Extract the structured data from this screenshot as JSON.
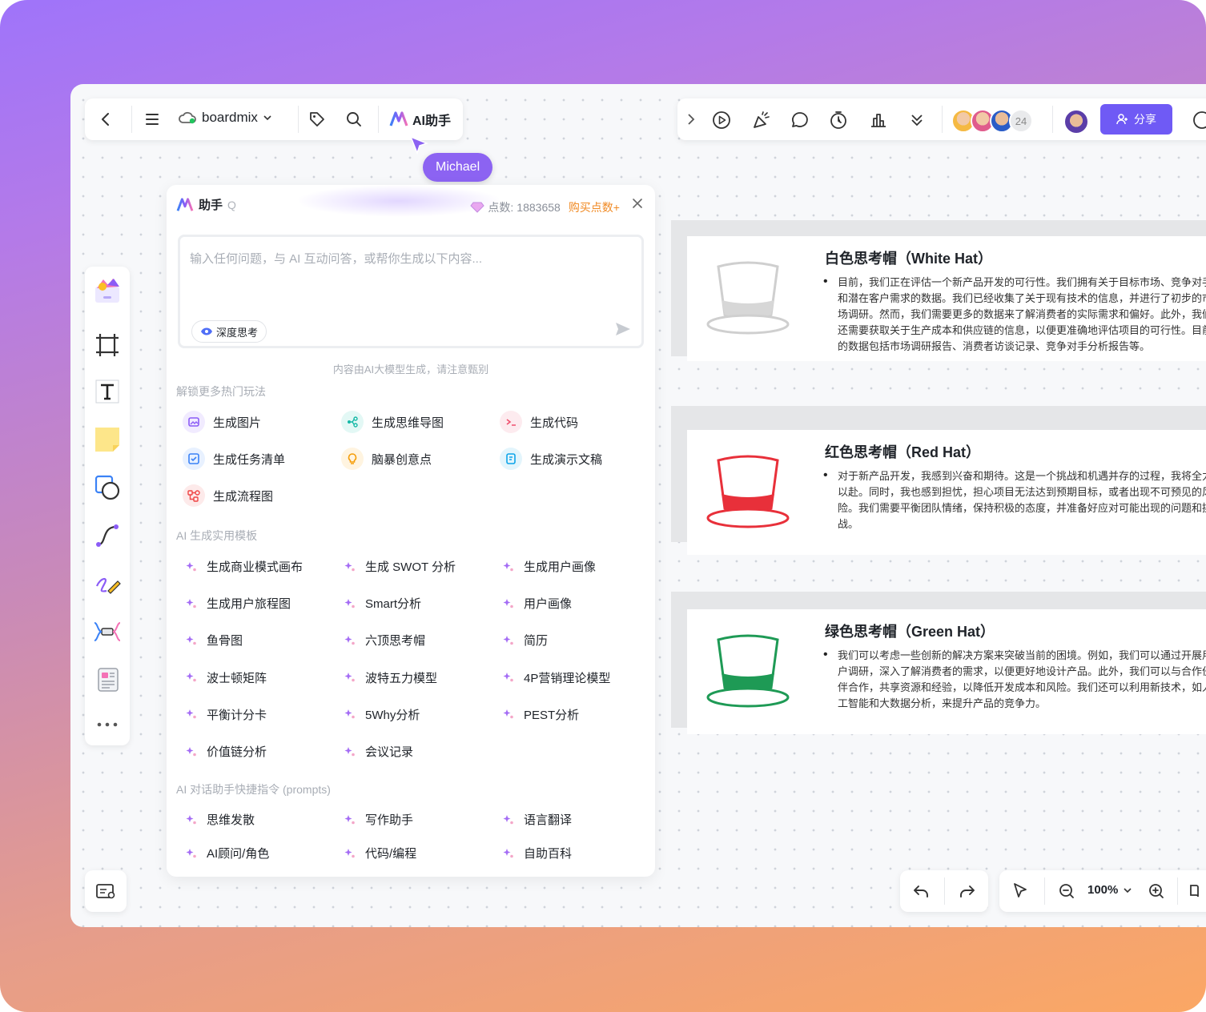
{
  "topbar": {
    "brand": "boardmix",
    "ai_label": "AI助手",
    "collaborator_count": "24",
    "share_label": "分享"
  },
  "cursor_name": "Michael",
  "ai_panel": {
    "title": "助手",
    "title_suffix": "Q",
    "points_label": "点数:",
    "points_value": "1883658",
    "buy_label": "购买点数+",
    "input_placeholder": "输入任何问题，与 AI 互动问答，或帮你生成以下内容...",
    "deep_think": "深度思考",
    "notice": "内容由AI大模型生成，请注意甄别",
    "section_hot": "解锁更多热门玩法",
    "features": [
      {
        "label": "生成图片",
        "icon": "image-icon",
        "color": "#8b5cf6",
        "bg": "#f1ebff"
      },
      {
        "label": "生成思维导图",
        "icon": "mindmap-icon",
        "color": "#14b8a6",
        "bg": "#e3f8f5"
      },
      {
        "label": "生成代码",
        "icon": "code-icon",
        "color": "#f0506e",
        "bg": "#fdebef"
      },
      {
        "label": "生成任务清单",
        "icon": "checklist-icon",
        "color": "#3b82f6",
        "bg": "#e8f1ff"
      },
      {
        "label": "脑暴创意点",
        "icon": "bulb-icon",
        "color": "#f59e0b",
        "bg": "#fff4e0"
      },
      {
        "label": "生成演示文稿",
        "icon": "presentation-icon",
        "color": "#0ea5e9",
        "bg": "#e3f5fc"
      },
      {
        "label": "生成流程图",
        "icon": "flowchart-icon",
        "color": "#ef4444",
        "bg": "#fdeaea"
      }
    ],
    "section_templates": "AI 生成实用模板",
    "templates": [
      "生成商业模式画布",
      "生成 SWOT 分析",
      "生成用户画像",
      "生成用户旅程图",
      "Smart分析",
      "用户画像",
      "鱼骨图",
      "六顶思考帽",
      "简历",
      "波士顿矩阵",
      "波特五力模型",
      "4P营销理论模型",
      "平衡计分卡",
      "5Why分析",
      "PEST分析",
      "价值链分析",
      "会议记录"
    ],
    "section_prompts": "AI 对话助手快捷指令 (prompts)",
    "prompts": [
      "思维发散",
      "写作助手",
      "语言翻译",
      "AI顾问/角色",
      "代码/编程",
      "自助百科"
    ]
  },
  "hats": [
    {
      "title": "白色思考帽（White Hat）",
      "color": "#cfcfcf",
      "fill": "#d7d7d7",
      "body": "目前，我们正在评估一个新产品开发的可行性。我们拥有关于目标市场、竞争对手和潜在客户需求的数据。我们已经收集了关于现有技术的信息，并进行了初步的市场调研。然而，我们需要更多的数据来了解消费者的实际需求和偏好。此外，我们还需要获取关于生产成本和供应链的信息，以便更准确地评估项目的可行性。目前的数据包括市场调研报告、消费者访谈记录、竞争对手分析报告等。"
    },
    {
      "title": "红色思考帽（Red Hat）",
      "color": "#e8303a",
      "fill": "#e8303a",
      "body": "对于新产品开发，我感到兴奋和期待。这是一个挑战和机遇并存的过程，我将全力以赴。同时，我也感到担忧，担心项目无法达到预期目标，或者出现不可预见的风险。我们需要平衡团队情绪，保持积极的态度，并准备好应对可能出现的问题和挑战。"
    },
    {
      "title": "绿色思考帽（Green Hat）",
      "color": "#1e9a55",
      "fill": "#1e9a55",
      "body": "我们可以考虑一些创新的解决方案来突破当前的困境。例如，我们可以通过开展用户调研，深入了解消费者的需求，以便更好地设计产品。此外，我们可以与合作伙伴合作，共享资源和经验，以降低开发成本和风险。我们还可以利用新技术，如人工智能和大数据分析，来提升产品的竞争力。"
    }
  ],
  "zoom": "100%"
}
